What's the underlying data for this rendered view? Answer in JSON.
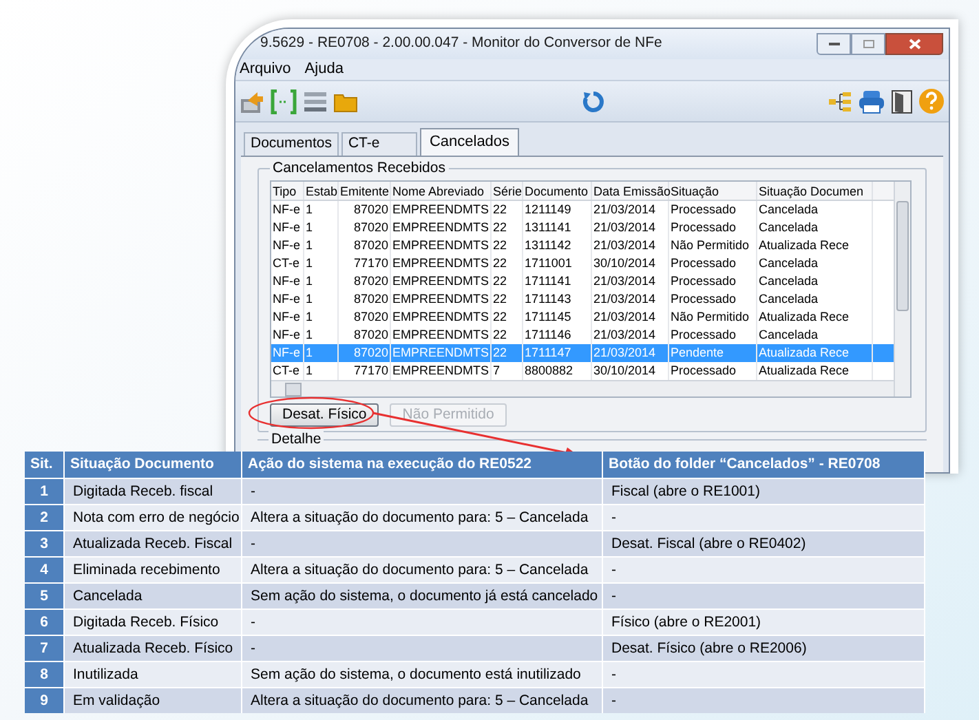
{
  "window": {
    "title": "9.5629 - RE0708 - 2.00.00.047 - Monitor do Conversor de NFe"
  },
  "menu": [
    "Arquivo",
    "Ajuda"
  ],
  "tabs": [
    {
      "label": "Documentos",
      "selected": false
    },
    {
      "label": "CT-e",
      "selected": false
    },
    {
      "label": "Cancelados",
      "selected": true
    }
  ],
  "group": {
    "title": "Cancelamentos Recebidos"
  },
  "grid": {
    "columns": [
      "Tipo",
      "Estab",
      "Emitente",
      "Nome Abreviado",
      "Série",
      "Documento",
      "Data Emissão",
      "Situação",
      "Situação Documen"
    ],
    "rows": [
      {
        "cells": [
          "NF-e",
          "1",
          "87020",
          "EMPREENDMTS",
          "22",
          "1211149",
          "21/03/2014",
          "Processado",
          "Cancelada"
        ],
        "selected": false
      },
      {
        "cells": [
          "NF-e",
          "1",
          "87020",
          "EMPREENDMTS",
          "22",
          "1311141",
          "21/03/2014",
          "Processado",
          "Cancelada"
        ],
        "selected": false
      },
      {
        "cells": [
          "NF-e",
          "1",
          "87020",
          "EMPREENDMTS",
          "22",
          "1311142",
          "21/03/2014",
          "Não Permitido",
          "Atualizada Rece"
        ],
        "selected": false
      },
      {
        "cells": [
          "CT-e",
          "1",
          "77170",
          "EMPREENDMTS",
          "22",
          "1711001",
          "30/10/2014",
          "Processado",
          "Cancelada"
        ],
        "selected": false
      },
      {
        "cells": [
          "NF-e",
          "1",
          "87020",
          "EMPREENDMTS",
          "22",
          "1711141",
          "21/03/2014",
          "Processado",
          "Cancelada"
        ],
        "selected": false
      },
      {
        "cells": [
          "NF-e",
          "1",
          "87020",
          "EMPREENDMTS",
          "22",
          "1711143",
          "21/03/2014",
          "Processado",
          "Cancelada"
        ],
        "selected": false
      },
      {
        "cells": [
          "NF-e",
          "1",
          "87020",
          "EMPREENDMTS",
          "22",
          "1711145",
          "21/03/2014",
          "Não Permitido",
          "Atualizada Rece"
        ],
        "selected": false
      },
      {
        "cells": [
          "NF-e",
          "1",
          "87020",
          "EMPREENDMTS",
          "22",
          "1711146",
          "21/03/2014",
          "Processado",
          "Cancelada"
        ],
        "selected": false
      },
      {
        "cells": [
          "NF-e",
          "1",
          "87020",
          "EMPREENDMTS",
          "22",
          "1711147",
          "21/03/2014",
          "Pendente",
          "Atualizada Rece"
        ],
        "selected": true
      },
      {
        "cells": [
          "CT-e",
          "1",
          "77170",
          "EMPREENDMTS",
          "7",
          "8800882",
          "30/10/2014",
          "Processado",
          "Atualizada Rece"
        ],
        "selected": false
      }
    ]
  },
  "buttons": [
    {
      "label": "Desat. Físico",
      "disabled": false
    },
    {
      "label": "Não Permitido",
      "disabled": true
    }
  ],
  "detail_group": {
    "title": "Detalhe"
  },
  "legend_table": {
    "columns": [
      "Sit.",
      "Situação Documento",
      "Ação do sistema na execução do RE0522",
      "Botão do folder “Cancelados” - RE0708"
    ],
    "rows": [
      [
        "1",
        "Digitada Receb. fiscal",
        "-",
        "Fiscal (abre o RE1001)"
      ],
      [
        "2",
        "Nota com erro de negócio",
        "Altera a situação do documento para:  5 – Cancelada",
        "-"
      ],
      [
        "3",
        "Atualizada Receb. Fiscal",
        "-",
        "Desat. Fiscal (abre o RE0402)"
      ],
      [
        "4",
        "Eliminada recebimento",
        "Altera a situação do documento para:  5 – Cancelada",
        "-"
      ],
      [
        "5",
        "Cancelada",
        "Sem ação do sistema, o documento já está cancelado",
        "-"
      ],
      [
        "6",
        "Digitada Receb. Físico",
        "-",
        "Físico (abre o RE2001)"
      ],
      [
        "7",
        "Atualizada Receb. Físico",
        "-",
        "Desat. Físico (abre o RE2006)"
      ],
      [
        "8",
        "Inutilizada",
        "Sem ação do sistema, o documento está inutilizado",
        "-"
      ],
      [
        "9",
        "Em validação",
        "Altera a situação do documento para:  5 – Cancelada",
        "-"
      ]
    ]
  }
}
